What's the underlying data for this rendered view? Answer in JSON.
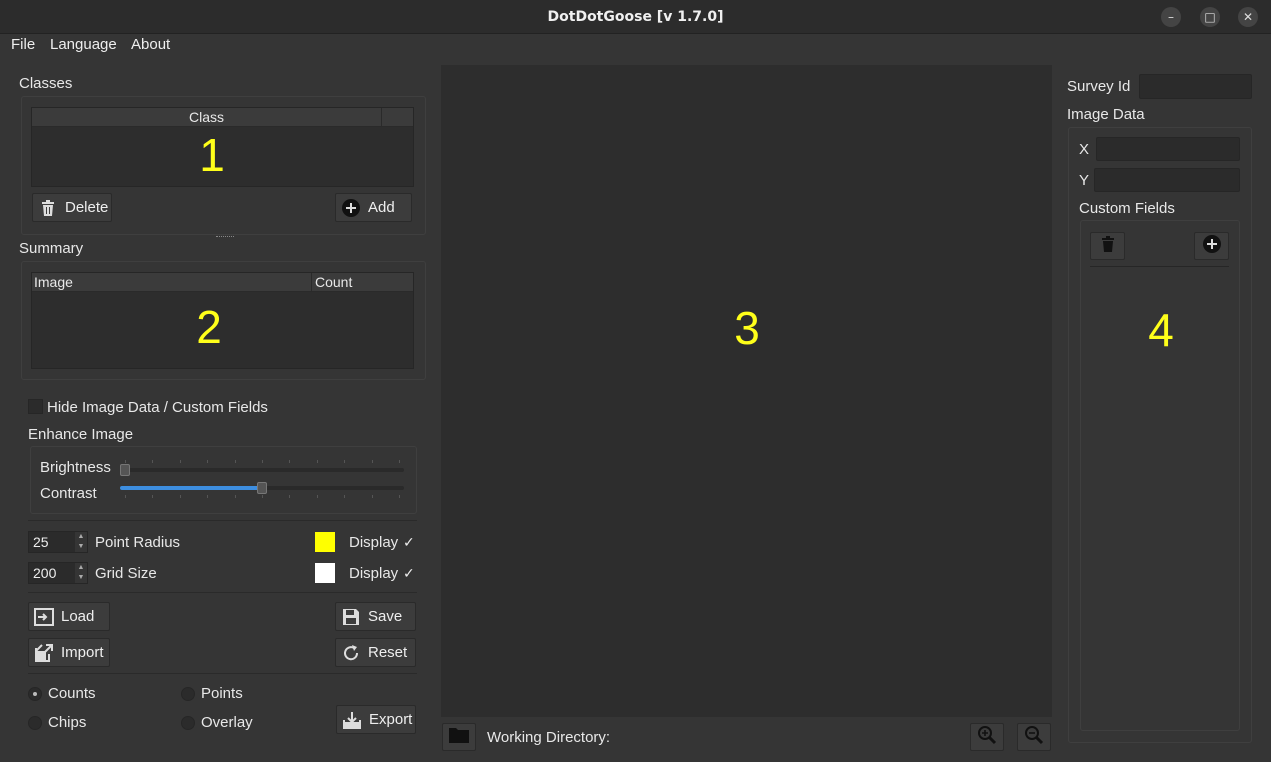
{
  "window": {
    "title": "DotDotGoose [v 1.7.0]",
    "controls": {
      "minimize": "–",
      "maximize": "□",
      "close": "✕"
    }
  },
  "menu": {
    "file": "File",
    "language": "Language",
    "about": "About"
  },
  "classes": {
    "title": "Classes",
    "column": "Class",
    "region_number": "1",
    "delete_label": "Delete",
    "add_label": "Add"
  },
  "summary": {
    "title": "Summary",
    "col_image": "Image",
    "col_count": "Count",
    "region_number": "2"
  },
  "hide_image_data_label": "Hide Image Data / Custom Fields",
  "enhance": {
    "title": "Enhance Image",
    "brightness_label": "Brightness",
    "contrast_label": "Contrast",
    "brightness_value": 0.0,
    "contrast_value": 0.5
  },
  "point_radius": {
    "value": "25",
    "label": "Point Radius",
    "display_label": "Display",
    "check": "✓",
    "color": "#ffff00"
  },
  "grid_size": {
    "value": "200",
    "label": "Grid Size",
    "display_label": "Display",
    "check": "✓",
    "color": "#ffffff"
  },
  "actions": {
    "load": "Load",
    "save": "Save",
    "import": "Import",
    "reset": "Reset",
    "export": "Export"
  },
  "export_options": {
    "counts": "Counts",
    "points": "Points",
    "chips": "Chips",
    "overlay": "Overlay",
    "selected": "Counts"
  },
  "canvas": {
    "region_number": "3"
  },
  "working_directory": {
    "label": "Working Directory:"
  },
  "right_panel": {
    "survey_id_label": "Survey Id",
    "image_data_label": "Image Data",
    "x_label": "X",
    "y_label": "Y",
    "custom_fields_label": "Custom Fields",
    "region_number": "4"
  },
  "colors": {
    "accent": "#3d8ee0",
    "highlight": "#ffff1a",
    "background": "#353535",
    "canvas": "#2d2d2d"
  }
}
